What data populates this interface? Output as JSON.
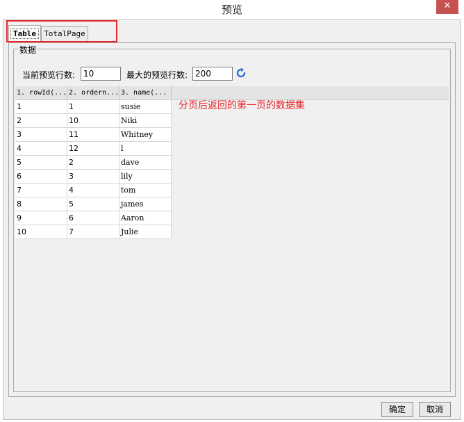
{
  "window": {
    "title": "预览",
    "close_symbol": "✕"
  },
  "tabs": [
    {
      "label": "Table",
      "active": true
    },
    {
      "label": "TotalPage",
      "active": false
    }
  ],
  "group": {
    "label": "数据",
    "current_rows_label": "当前预览行数:",
    "current_rows_value": "10",
    "max_rows_label": "最大的预览行数:",
    "max_rows_value": "200",
    "refresh_icon": "refresh-icon"
  },
  "table": {
    "columns": [
      "1. rowId(...",
      "2. ordern...",
      "3. name(..."
    ],
    "rows": [
      [
        "1",
        "1",
        "susie"
      ],
      [
        "2",
        "10",
        "Niki"
      ],
      [
        "3",
        "11",
        "Whitney"
      ],
      [
        "4",
        "12",
        "l"
      ],
      [
        "5",
        "2",
        "dave"
      ],
      [
        "6",
        "3",
        "lily"
      ],
      [
        "7",
        "4",
        "tom"
      ],
      [
        "8",
        "5",
        "james"
      ],
      [
        "9",
        "6",
        "Aaron"
      ],
      [
        "10",
        "7",
        "Julie"
      ]
    ]
  },
  "annotation": "分页后返回的第一页的数据集",
  "buttons": {
    "ok": "确定",
    "cancel": "取消"
  },
  "colors": {
    "annotation": "#e8262a",
    "close": "#c75050",
    "refresh": "#2a6fd6"
  }
}
